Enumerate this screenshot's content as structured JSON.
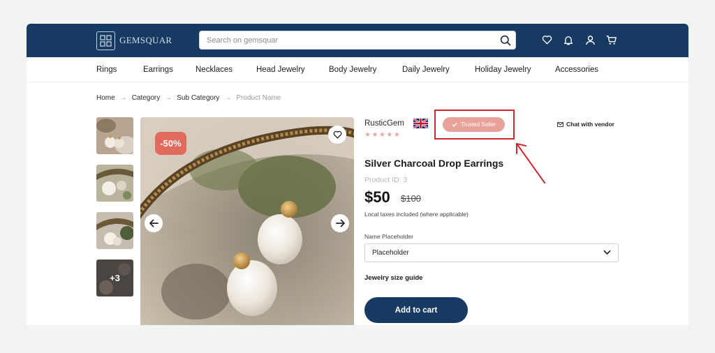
{
  "brand": {
    "name": "GEMSQUAR"
  },
  "search": {
    "placeholder": "Search on gemsquar"
  },
  "categories": [
    "Rings",
    "Earrings",
    "Necklaces",
    "Head Jewelry",
    "Body Jewelry",
    "Daily Jewelry",
    "Holiday Jewelry",
    "Accessories"
  ],
  "breadcrumb": [
    "Home",
    "Category",
    "Sub Category",
    "Product Name"
  ],
  "gallery": {
    "more_label": "+3",
    "discount": "-50%"
  },
  "vendor": {
    "name": "RusticGem",
    "rating_stars": 5,
    "trusted_label": "Trusted Seller",
    "chat_label": "Chat with vendor"
  },
  "product": {
    "title": "Silver Charcoal Drop Earrings",
    "product_id": "Product ID: 3",
    "price": "$50",
    "old_price": "$100",
    "tax_note": "Local taxes included (where applicable)"
  },
  "option": {
    "label": "Name Placeholder",
    "value": "Placeholder"
  },
  "size_guide": "Jewelry size guide",
  "add_to_cart": "Add to cart",
  "colors": {
    "navy": "#173a63",
    "discount": "#e06a5b",
    "trusted": "#e8a29a",
    "highlight": "#d0252b"
  }
}
